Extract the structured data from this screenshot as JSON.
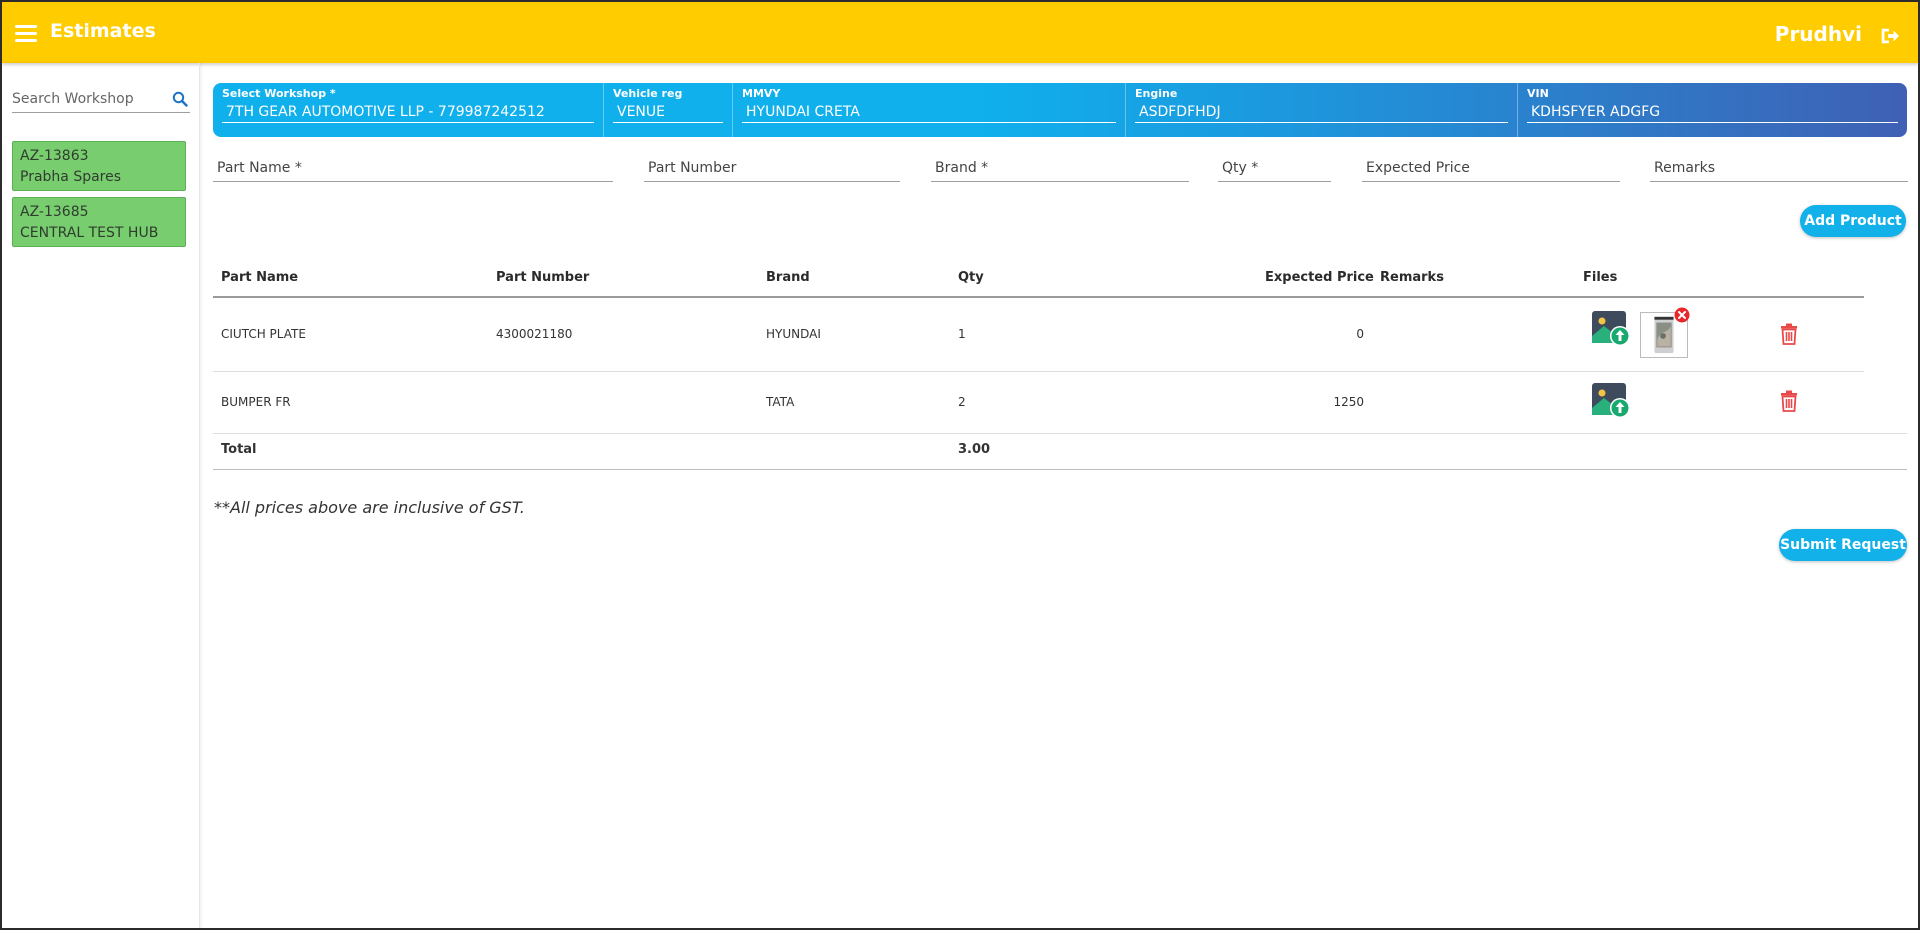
{
  "header": {
    "title": "Estimates",
    "user": "Prudhvi"
  },
  "sidebar": {
    "search_placeholder": "Search Workshop",
    "workshops": [
      {
        "code": "AZ-13863",
        "name": "Prabha Spares"
      },
      {
        "code": "AZ-13685",
        "name": "CENTRAL TEST HUB"
      }
    ]
  },
  "vehicle": {
    "workshop": {
      "label": "Select Workshop *",
      "value": "7TH GEAR AUTOMOTIVE LLP - 779987242512"
    },
    "vehicle_reg": {
      "label": "Vehicle reg",
      "value": "VENUE"
    },
    "mmvy": {
      "label": "MMVY",
      "value": "HYUNDAI CRETA"
    },
    "engine": {
      "label": "Engine",
      "value": "ASDFDFHDJ"
    },
    "vin": {
      "label": "VIN",
      "value": "KDHSFYER ADGFG"
    }
  },
  "entry": {
    "part_name": "Part Name *",
    "part_number": "Part Number",
    "brand": "Brand *",
    "qty": "Qty *",
    "expected_price": "Expected Price",
    "remarks": "Remarks",
    "add_button": "Add Product"
  },
  "table": {
    "headers": {
      "part_name": "Part Name",
      "part_number": "Part Number",
      "brand": "Brand",
      "qty": "Qty",
      "expected_price": "Expected Price",
      "remarks": "Remarks",
      "files": "Files"
    },
    "rows": [
      {
        "part_name": "CIUTCH PLATE",
        "part_number": "4300021180",
        "brand": "HYUNDAI",
        "qty": "1",
        "expected_price": "0",
        "remarks": ""
      },
      {
        "part_name": "BUMPER FR",
        "part_number": "",
        "brand": "TATA",
        "qty": "2",
        "expected_price": "1250",
        "remarks": ""
      }
    ],
    "total_label": "Total",
    "total_qty": "3.00"
  },
  "note": "**All prices above are inclusive of GST.",
  "submit_button": "Submit Request",
  "colors": {
    "header_bg": "#ffcc00",
    "accent_blue": "#13b1ea",
    "workshop_green": "#78cd6f",
    "delete_red": "#e84a4a"
  },
  "icons": [
    "menu-icon",
    "logout-icon",
    "search-icon",
    "image-upload-icon",
    "remove-icon",
    "trash-icon"
  ]
}
